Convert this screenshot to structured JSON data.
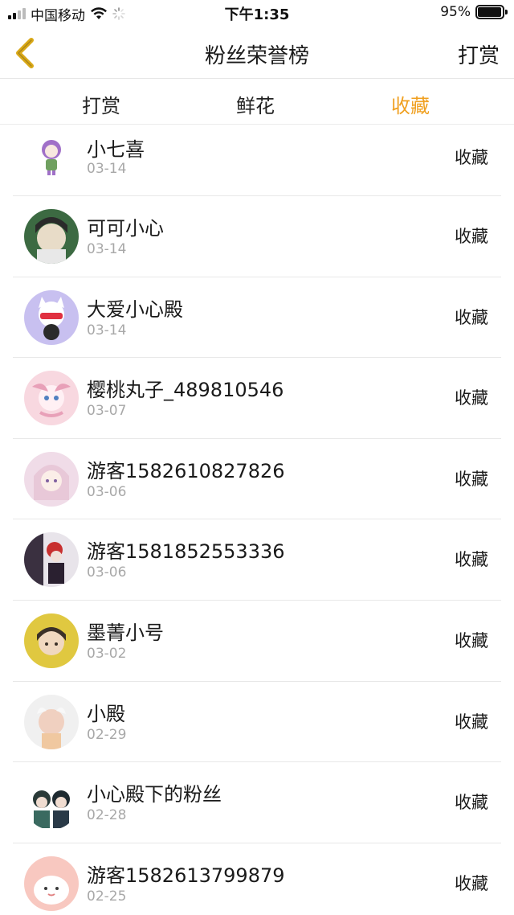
{
  "status_bar": {
    "carrier": "中国移动",
    "time": "下午1:35",
    "battery": "95%"
  },
  "nav": {
    "title": "粉丝荣誉榜",
    "action": "打赏"
  },
  "tabs": [
    {
      "label": "打赏",
      "active": false
    },
    {
      "label": "鲜花",
      "active": false
    },
    {
      "label": "收藏",
      "active": true
    }
  ],
  "colors": {
    "accent": "#f0a020",
    "back_icon": "#d9a816"
  },
  "list": [
    {
      "name": "小七喜",
      "date": "03-14",
      "action": "收藏",
      "avatar_colors": [
        "#f4f0fa",
        "#a070c8"
      ]
    },
    {
      "name": "可可小心",
      "date": "03-14",
      "action": "收藏",
      "avatar_colors": [
        "#3c6a42",
        "#e8dcc8"
      ]
    },
    {
      "name": "大爱小心殿",
      "date": "03-14",
      "action": "收藏",
      "avatar_colors": [
        "#c8c0f0",
        "#ffffff"
      ]
    },
    {
      "name": "樱桃丸子_489810546",
      "date": "03-07",
      "action": "收藏",
      "avatar_colors": [
        "#f8d8e0",
        "#e8a0b8"
      ]
    },
    {
      "name": "游客1582610827826",
      "date": "03-06",
      "action": "收藏",
      "avatar_colors": [
        "#f0dce8",
        "#c8a8c8"
      ]
    },
    {
      "name": "游客1581852553336",
      "date": "03-06",
      "action": "收藏",
      "avatar_colors": [
        "#3a3040",
        "#c83030"
      ]
    },
    {
      "name": "墨菁小号",
      "date": "03-02",
      "action": "收藏",
      "avatar_colors": [
        "#e0c840",
        "#3a3028"
      ]
    },
    {
      "name": "小殿",
      "date": "02-29",
      "action": "收藏",
      "avatar_colors": [
        "#f0f0f0",
        "#e8c8b8"
      ]
    },
    {
      "name": "小心殿下的粉丝",
      "date": "02-28",
      "action": "收藏",
      "avatar_colors": [
        "#ffffff",
        "#2a3a38"
      ]
    },
    {
      "name": "游客1582613799879",
      "date": "02-25",
      "action": "收藏",
      "avatar_colors": [
        "#f8c8c0",
        "#ffffff"
      ]
    }
  ]
}
